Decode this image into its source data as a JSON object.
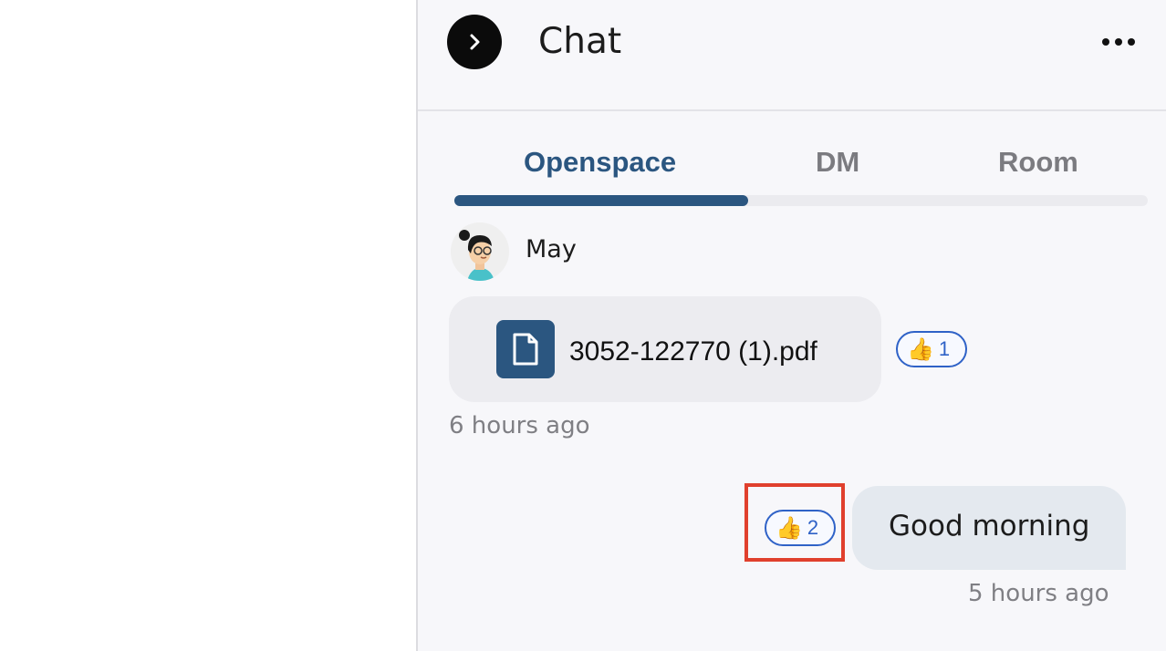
{
  "header": {
    "title": "Chat"
  },
  "tabs": [
    {
      "label": "Openspace",
      "active": true
    },
    {
      "label": "DM",
      "active": false
    },
    {
      "label": "Room",
      "active": false
    }
  ],
  "messages": [
    {
      "sender": "May",
      "attachment": {
        "file_name": "3052-122770 (1).pdf",
        "icon": "file-icon"
      },
      "reaction": {
        "emoji": "👍",
        "count": "1"
      },
      "time": "6 hours ago"
    },
    {
      "text": "Good morning",
      "reaction": {
        "emoji": "👍",
        "count": "2"
      },
      "time": "5 hours ago"
    }
  ],
  "colors": {
    "accent": "#2b5680",
    "reaction_border": "#2f62c7",
    "highlight": "#e0402d",
    "panel_bg": "#f7f7fa"
  }
}
